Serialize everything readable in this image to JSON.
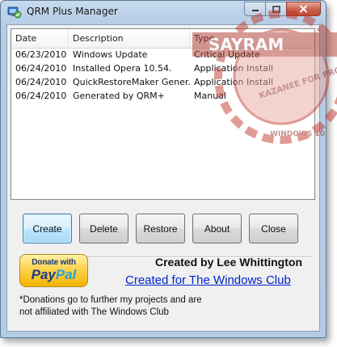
{
  "window": {
    "title": "QRM Plus Manager",
    "accent": "#3c7fb1"
  },
  "listview": {
    "columns": [
      "Date",
      "Description",
      "Type"
    ],
    "rows": [
      {
        "date": "06/23/2010",
        "description": "Windows Update",
        "type": "Critical Update"
      },
      {
        "date": "06/24/2010",
        "description": "Installed Opera 10.54.",
        "type": "Application Install"
      },
      {
        "date": "06/24/2010",
        "description": "QuickRestoreMaker Gener...",
        "type": "Application Install"
      },
      {
        "date": "06/24/2010",
        "description": "Generated by QRM+",
        "type": "Manual"
      }
    ]
  },
  "buttons": {
    "create": "Create",
    "delete": "Delete",
    "restore": "Restore",
    "about": "About",
    "close": "Close"
  },
  "paypal": {
    "top": "Donate with",
    "pay": "Pay",
    "pal": "Pal"
  },
  "footer": {
    "author": "Created by Lee Whittington",
    "link": "Created for The Windows Club",
    "note": "*Donations go to further my projects and are not affiliated with The Windows Club"
  },
  "watermark": {
    "line1": "SAYRAM",
    "line2": "KAZANEE FOR PRO",
    "line3": "WINDOWS 10"
  }
}
